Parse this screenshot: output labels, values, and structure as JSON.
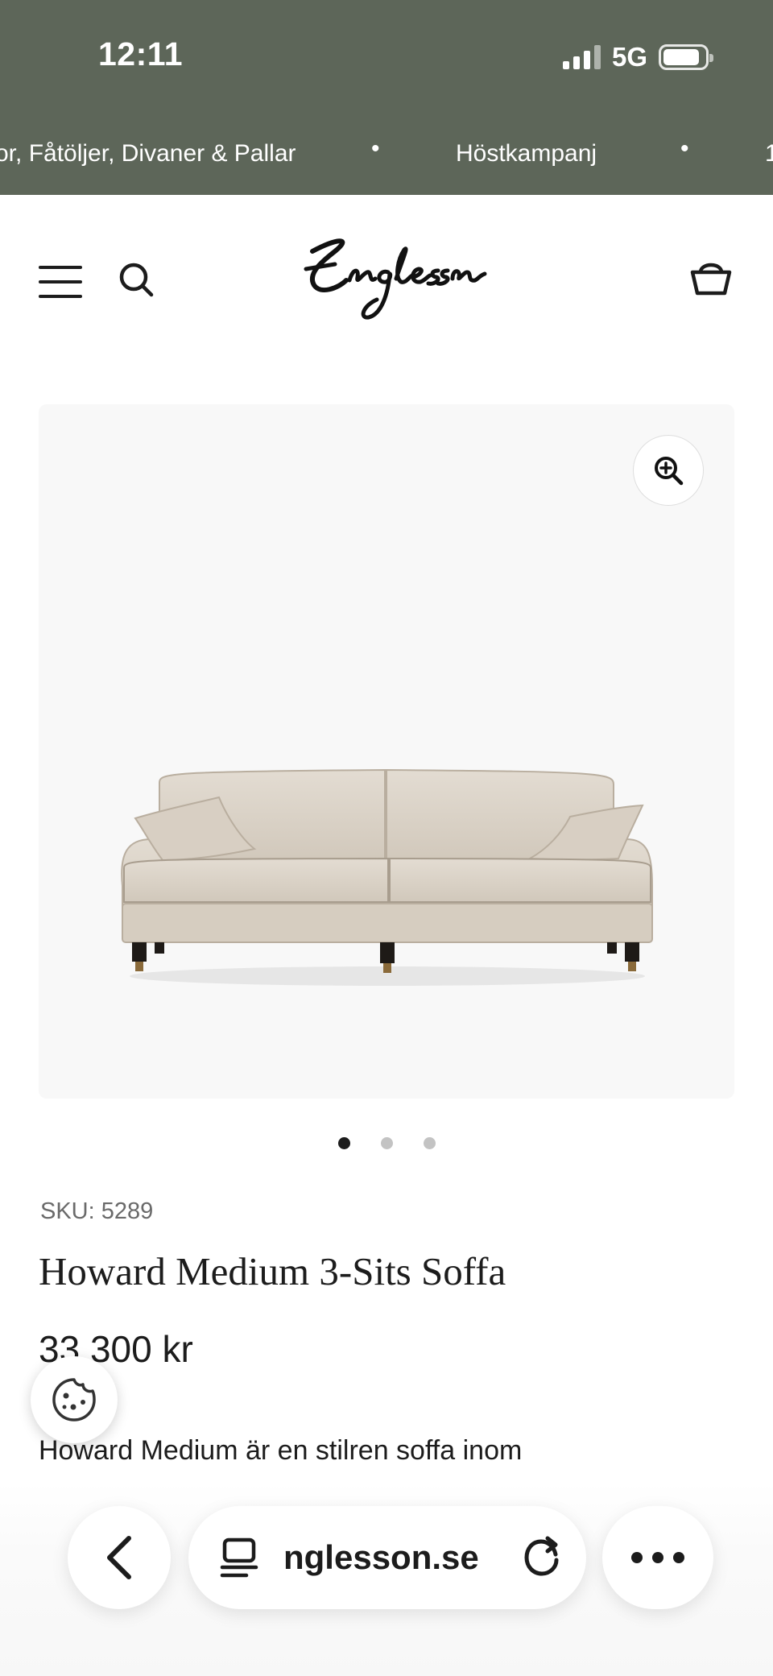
{
  "status_bar": {
    "time": "12:11",
    "network": "5G",
    "battery_level": 0.8
  },
  "announcement": {
    "items": [
      "or, Fåtöljer, Divaner & Pallar",
      "Höstkampanj",
      "1"
    ],
    "separator": "•"
  },
  "header": {
    "menu_icon": "hamburger-menu-icon",
    "search_icon": "search-icon",
    "logo_text": "Englesson",
    "cart_icon": "basket-icon"
  },
  "gallery": {
    "zoom_icon": "zoom-in-icon",
    "image": "sofa-product-image",
    "slide_count": 3,
    "active_slide": 1
  },
  "product": {
    "sku": "SKU: 5289",
    "title": "Howard Medium 3-Sits Soffa",
    "price": "33 300 kr",
    "description": "Howard Medium är en stilren soffa inom"
  },
  "cookie": {
    "icon": "cookie-icon"
  },
  "browser": {
    "back_icon": "chevron-left-icon",
    "tab_icon": "tabs-icon",
    "url": "nglesson.se",
    "reload_icon": "reload-icon",
    "more_icon": "more-dots-icon"
  },
  "colors": {
    "top_bar": "#5d6659",
    "text": "#1c1c1c",
    "gallery_bg": "#f8f8f8",
    "sofa_fabric": "#ddd5ca"
  }
}
